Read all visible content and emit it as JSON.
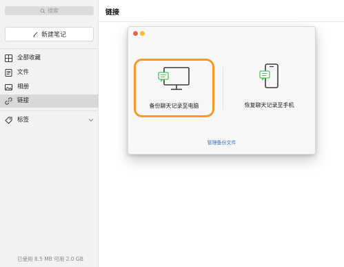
{
  "sidebar": {
    "search_placeholder": "搜索",
    "new_note_label": "新建笔记",
    "items": [
      {
        "label": "全部收藏",
        "icon": "grid-icon"
      },
      {
        "label": "文件",
        "icon": "file-icon"
      },
      {
        "label": "相册",
        "icon": "image-icon"
      },
      {
        "label": "链接",
        "icon": "link-icon",
        "active": true
      },
      {
        "label": "标签",
        "icon": "tag-icon"
      }
    ],
    "storage": "已使用 8.5 MB 可用 2.0 GB"
  },
  "main": {
    "title": "链接"
  },
  "dialog": {
    "option_pc_label": "备份聊天记录至电脑",
    "option_phone_label": "恢复聊天记录至手机",
    "manage_link": "管理备份文件"
  },
  "colors": {
    "highlight": "#f39a2c",
    "link": "#3b6fbf",
    "chat_green": "#52c25c"
  }
}
